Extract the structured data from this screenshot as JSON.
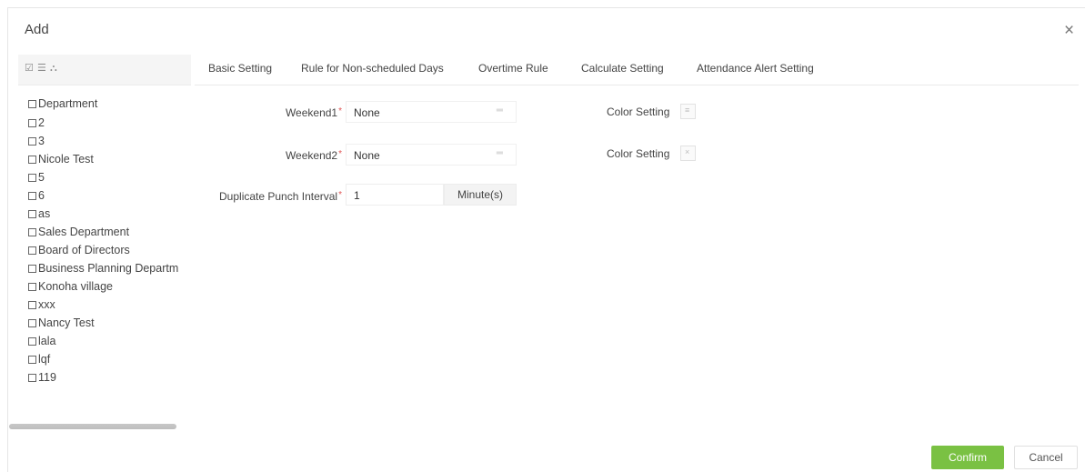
{
  "dialog": {
    "title": "Add",
    "close_glyph": "×"
  },
  "tree": {
    "toolbar_icons": [
      "check-all-icon",
      "list-icon",
      "hierarchy-icon"
    ],
    "items": [
      {
        "label": "Department"
      },
      {
        "label": "2"
      },
      {
        "label": "3"
      },
      {
        "label": "Nicole Test"
      },
      {
        "label": "5"
      },
      {
        "label": "6"
      },
      {
        "label": "as"
      },
      {
        "label": "Sales Department"
      },
      {
        "label": "Board of Directors"
      },
      {
        "label": "Business Planning Departm"
      },
      {
        "label": "Konoha village"
      },
      {
        "label": "xxx"
      },
      {
        "label": "Nancy Test"
      },
      {
        "label": "lala"
      },
      {
        "label": "lqf"
      },
      {
        "label": "119"
      }
    ]
  },
  "tabs": [
    {
      "label": "Basic Setting"
    },
    {
      "label": "Rule for Non-scheduled Days"
    },
    {
      "label": "Overtime Rule"
    },
    {
      "label": "Calculate Setting"
    },
    {
      "label": "Attendance Alert Setting"
    }
  ],
  "form": {
    "weekend1": {
      "label": "Weekend1",
      "required_mark": "*",
      "value": "None"
    },
    "weekend2": {
      "label": "Weekend2",
      "required_mark": "*",
      "value": "None"
    },
    "duplicate_punch": {
      "label": "Duplicate Punch Interval",
      "required_mark": "*",
      "value": "1",
      "unit": "Minute(s)"
    },
    "color_setting_1": {
      "label": "Color Setting"
    },
    "color_setting_2": {
      "label": "Color Setting"
    }
  },
  "footer": {
    "confirm_label": "Confirm",
    "cancel_label": "Cancel"
  },
  "colors": {
    "confirm_green": "#7ac143",
    "required_red": "#e05555"
  }
}
